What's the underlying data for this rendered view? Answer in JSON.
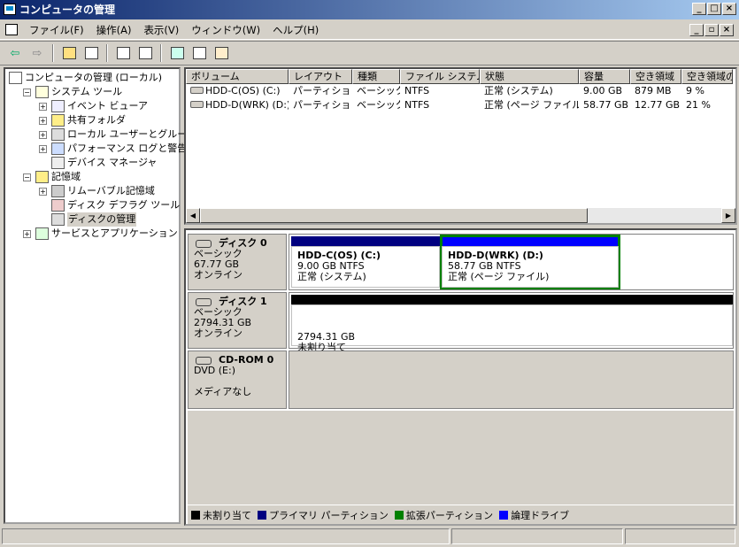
{
  "window": {
    "title": "コンピュータの管理",
    "minimize": "_",
    "maximize": "□",
    "close": "×"
  },
  "menu": {
    "items": [
      "ファイル(F)",
      "操作(A)",
      "表示(V)",
      "ウィンドウ(W)",
      "ヘルプ(H)"
    ],
    "child_min": "_",
    "child_restore": "▫",
    "child_close": "×"
  },
  "toolbar": {
    "icons": [
      "back-arrow-icon",
      "forward-arrow-icon",
      "up-folder-icon",
      "show-hide-tree-icon",
      "help-icon",
      "properties-icon",
      "refresh-icon",
      "export-list-icon",
      "rescan-disks-icon"
    ],
    "back": "⇦",
    "forward": "⇨"
  },
  "tree": {
    "items": [
      {
        "label": "コンピュータの管理 (ローカル)",
        "level": 0,
        "expander": "",
        "icon": "computer-icon"
      },
      {
        "label": "システム ツール",
        "level": 1,
        "expander": "−",
        "icon": "tools-icon"
      },
      {
        "label": "イベント ビューア",
        "level": 2,
        "expander": "+",
        "icon": "event-viewer-icon"
      },
      {
        "label": "共有フォルダ",
        "level": 2,
        "expander": "+",
        "icon": "shared-folder-icon"
      },
      {
        "label": "ローカル ユーザーとグループ",
        "level": 2,
        "expander": "+",
        "icon": "users-icon"
      },
      {
        "label": "パフォーマンス ログと警告",
        "level": 2,
        "expander": "+",
        "icon": "performance-icon"
      },
      {
        "label": "デバイス マネージャ",
        "level": 2,
        "expander": "",
        "icon": "device-manager-icon"
      },
      {
        "label": "記憶域",
        "level": 1,
        "expander": "−",
        "icon": "storage-icon"
      },
      {
        "label": "リムーバブル記憶域",
        "level": 2,
        "expander": "+",
        "icon": "removable-storage-icon"
      },
      {
        "label": "ディスク デフラグ ツール",
        "level": 2,
        "expander": "",
        "icon": "defrag-icon"
      },
      {
        "label": "ディスクの管理",
        "level": 2,
        "expander": "",
        "icon": "disk-management-icon",
        "selected": true
      },
      {
        "label": "サービスとアプリケーション",
        "level": 1,
        "expander": "+",
        "icon": "services-icon"
      }
    ]
  },
  "volumes": {
    "columns": [
      "ボリューム",
      "レイアウト",
      "種類",
      "ファイル システム",
      "状態",
      "容量",
      "空き領域",
      "空き領域の"
    ],
    "rows": [
      [
        "HDD-C(OS) (C:)",
        "パーティション",
        "ベーシック",
        "NTFS",
        "正常 (システム)",
        "9.00 GB",
        "879 MB",
        "9 %"
      ],
      [
        "HDD-D(WRK) (D:)",
        "パーティション",
        "ベーシック",
        "NTFS",
        "正常 (ページ ファイル)",
        "58.77 GB",
        "12.77 GB",
        "21 %"
      ]
    ],
    "scroll_left": "◀",
    "scroll_right": "▶"
  },
  "disks": [
    {
      "name": "ディスク 0",
      "type": "ベーシック",
      "size": "67.77 GB",
      "status": "オンライン",
      "volumes": [
        {
          "name": "HDD-C(OS)  (C:)",
          "info": "9.00 GB NTFS",
          "status": "正常 (システム)",
          "color": "#000080"
        },
        {
          "name": "HDD-D(WRK)  (D:)",
          "info": "58.77 GB NTFS",
          "status": "正常 (ページ ファイル)",
          "color": "#0000ff"
        }
      ]
    },
    {
      "name": "ディスク 1",
      "type": "ベーシック",
      "size": "2794.31 GB",
      "status": "オンライン",
      "volumes": [
        {
          "name": "",
          "info": "2794.31 GB",
          "status": "未割り当て",
          "color": "#000000"
        }
      ]
    },
    {
      "name": "CD-ROM 0",
      "type": "DVD (E:)",
      "size": "",
      "status": "メディアなし",
      "volumes": []
    }
  ],
  "legend": [
    {
      "label": "未割り当て",
      "color": "#000000"
    },
    {
      "label": "プライマリ パーティション",
      "color": "#000080"
    },
    {
      "label": "拡張パーティション",
      "color": "#008000"
    },
    {
      "label": "論理ドライブ",
      "color": "#0000ff"
    }
  ],
  "colors": {
    "selection_outline": "#008000",
    "title_start": "#0a246a",
    "title_end": "#a6caf0"
  }
}
